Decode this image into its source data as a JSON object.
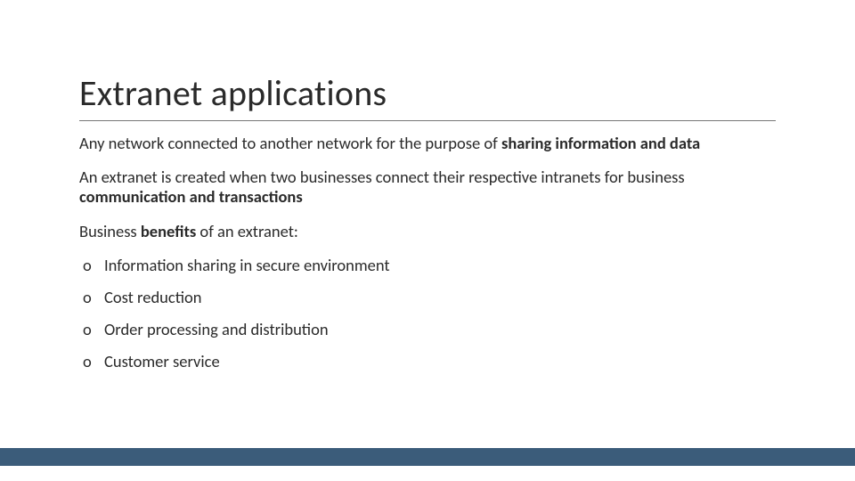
{
  "title": "Extranet applications",
  "paragraphs": {
    "p1_a": "Any network connected to another network for the purpose of ",
    "p1_b": "sharing information and data",
    "p2_a": "An extranet is created when two businesses connect their respective intranets for business ",
    "p2_b": "communication and transactions",
    "p3_a": "Business ",
    "p3_b": "benefits",
    "p3_c": " of an extranet:"
  },
  "bullet_marker": "o",
  "bullets": [
    "Information sharing in secure environment",
    "Cost reduction",
    "Order processing and distribution",
    "Customer service"
  ],
  "colors": {
    "footer_bar": "#3b5c7a"
  }
}
